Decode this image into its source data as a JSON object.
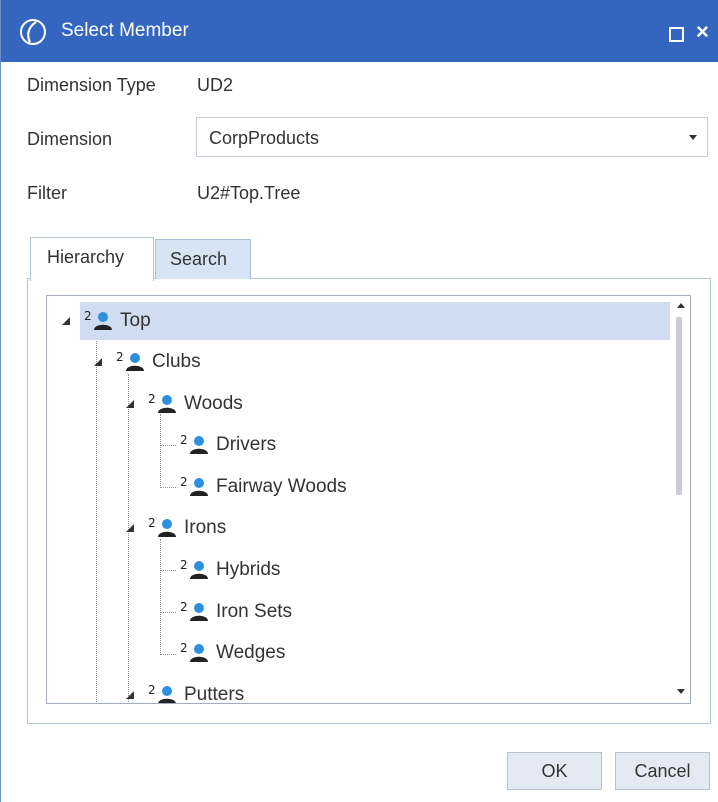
{
  "window": {
    "title": "Select Member"
  },
  "fields": {
    "dimension_type_label": "Dimension Type",
    "dimension_type_value": "UD2",
    "dimension_label": "Dimension",
    "dimension_value": "CorpProducts",
    "filter_label": "Filter",
    "filter_value": "U2#Top.Tree"
  },
  "tabs": [
    {
      "label": "Hierarchy",
      "active": true
    },
    {
      "label": "Search",
      "active": false
    }
  ],
  "tree": {
    "nodes": [
      {
        "label": "Top",
        "level": 0,
        "expanded": true,
        "selected": true,
        "icon": "member-icon"
      },
      {
        "label": "Clubs",
        "level": 1,
        "expanded": true,
        "icon": "member-icon"
      },
      {
        "label": "Woods",
        "level": 2,
        "expanded": true,
        "icon": "member-icon"
      },
      {
        "label": "Drivers",
        "level": 3,
        "icon": "member-icon"
      },
      {
        "label": "Fairway Woods",
        "level": 3,
        "icon": "member-icon"
      },
      {
        "label": "Irons",
        "level": 2,
        "expanded": true,
        "icon": "member-icon"
      },
      {
        "label": "Hybrids",
        "level": 3,
        "icon": "member-icon"
      },
      {
        "label": "Iron Sets",
        "level": 3,
        "icon": "member-icon"
      },
      {
        "label": "Wedges",
        "level": 3,
        "icon": "member-icon"
      },
      {
        "label": "Putters",
        "level": 2,
        "expanded": true,
        "icon": "member-icon"
      }
    ],
    "icon_badge": "2"
  },
  "buttons": {
    "ok": "OK",
    "cancel": "Cancel"
  },
  "colors": {
    "titlebar": "#3466c0",
    "selection": "#cfdcf2",
    "tab_inactive": "#d6e4f5"
  }
}
